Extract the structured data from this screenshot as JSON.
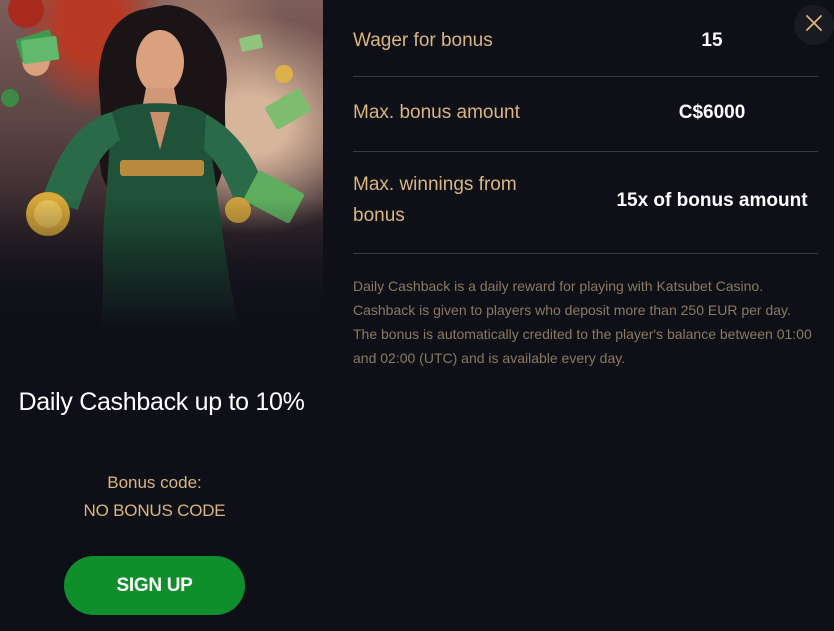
{
  "promo": {
    "title": "Daily Cashback up to 10%",
    "bonus_code_label": "Bonus code:",
    "bonus_code_value": "NO BONUS CODE",
    "signup_label": "SIGN UP"
  },
  "details": [
    {
      "label": "Wager for bonus",
      "value": "15"
    },
    {
      "label": "Max. bonus amount",
      "value": "C$6000"
    },
    {
      "label": "Max. winnings from bonus",
      "value": "15x of bonus amount"
    }
  ],
  "description": "Daily Cashback is a daily reward for playing with Katsubet Casino. Cashback is given to players who deposit more than 250 EUR per day. The bonus is automatically credited to the player's balance between 01:00 and 02:00 (UTC) and is available every day.",
  "icons": {
    "close": "close-icon"
  },
  "colors": {
    "background": "#0e0f17",
    "accent_gold": "#d8b67e",
    "signup_green": "#0f8f2c",
    "divider": "#3a3b44",
    "description": "#8a7a62"
  }
}
